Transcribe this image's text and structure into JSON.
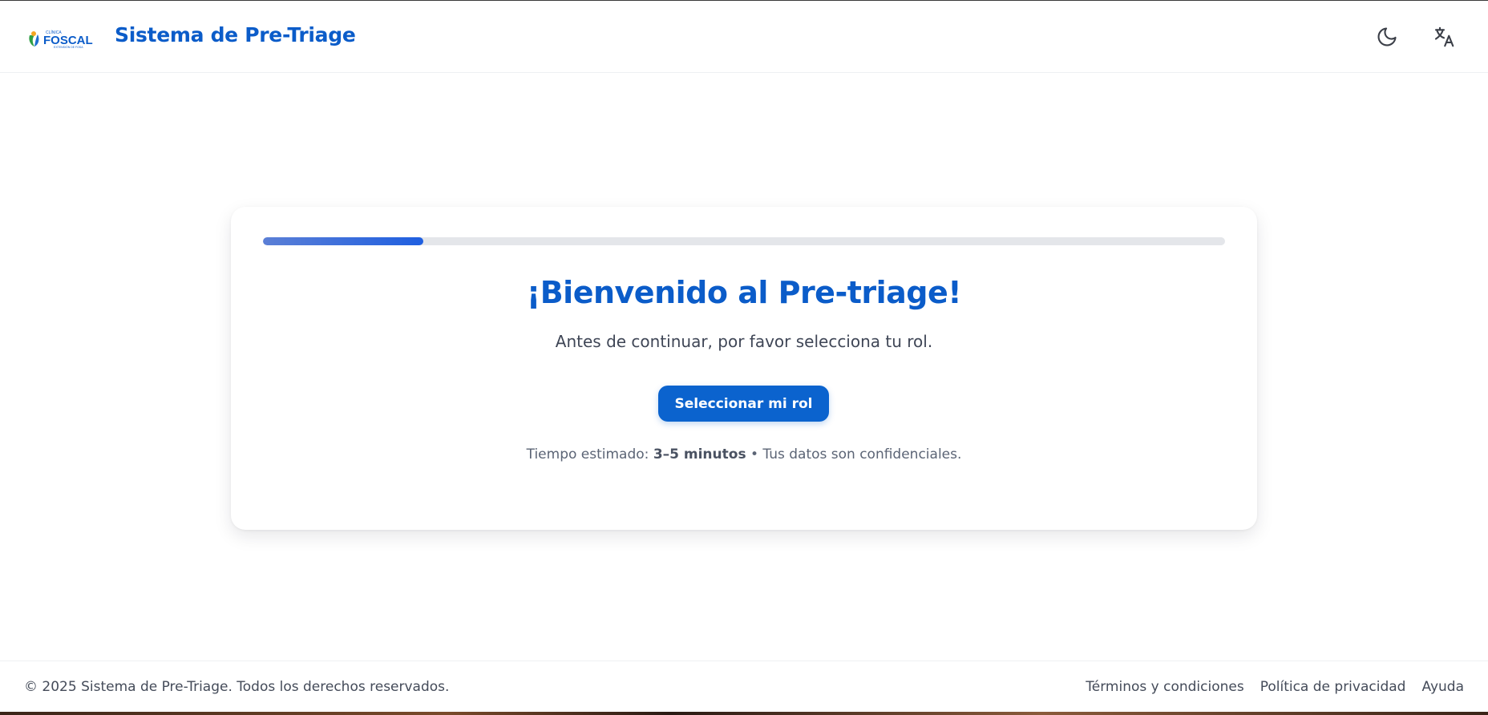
{
  "header": {
    "logo": {
      "small": "CLÍNICA",
      "brand": "FOSCAL",
      "tagline": "EXTENSIÓN DE FOSA"
    },
    "title": "Sistema de Pre-Triage",
    "icons": [
      "moon-icon",
      "translate-icon"
    ]
  },
  "card": {
    "progress_percent": 16.7,
    "title": "¡Bienvenido al Pre-triage!",
    "subtitle": "Antes de continuar, por favor selecciona tu rol.",
    "button_label": "Seleccionar mi rol",
    "meta": {
      "prefix": "Tiempo estimado: ",
      "duration": "3–5 minutos",
      "suffix": " • Tus datos son confidenciales."
    }
  },
  "footer": {
    "copyright": "© 2025 Sistema de Pre-Triage. Todos los derechos reservados.",
    "links": [
      "Términos y condiciones",
      "Política de privacidad",
      "Ayuda"
    ]
  },
  "colors": {
    "brand": "#0b5cc9",
    "button": "#0b63ce",
    "progress": "#1f5fe0",
    "track": "#e4e6ea"
  }
}
